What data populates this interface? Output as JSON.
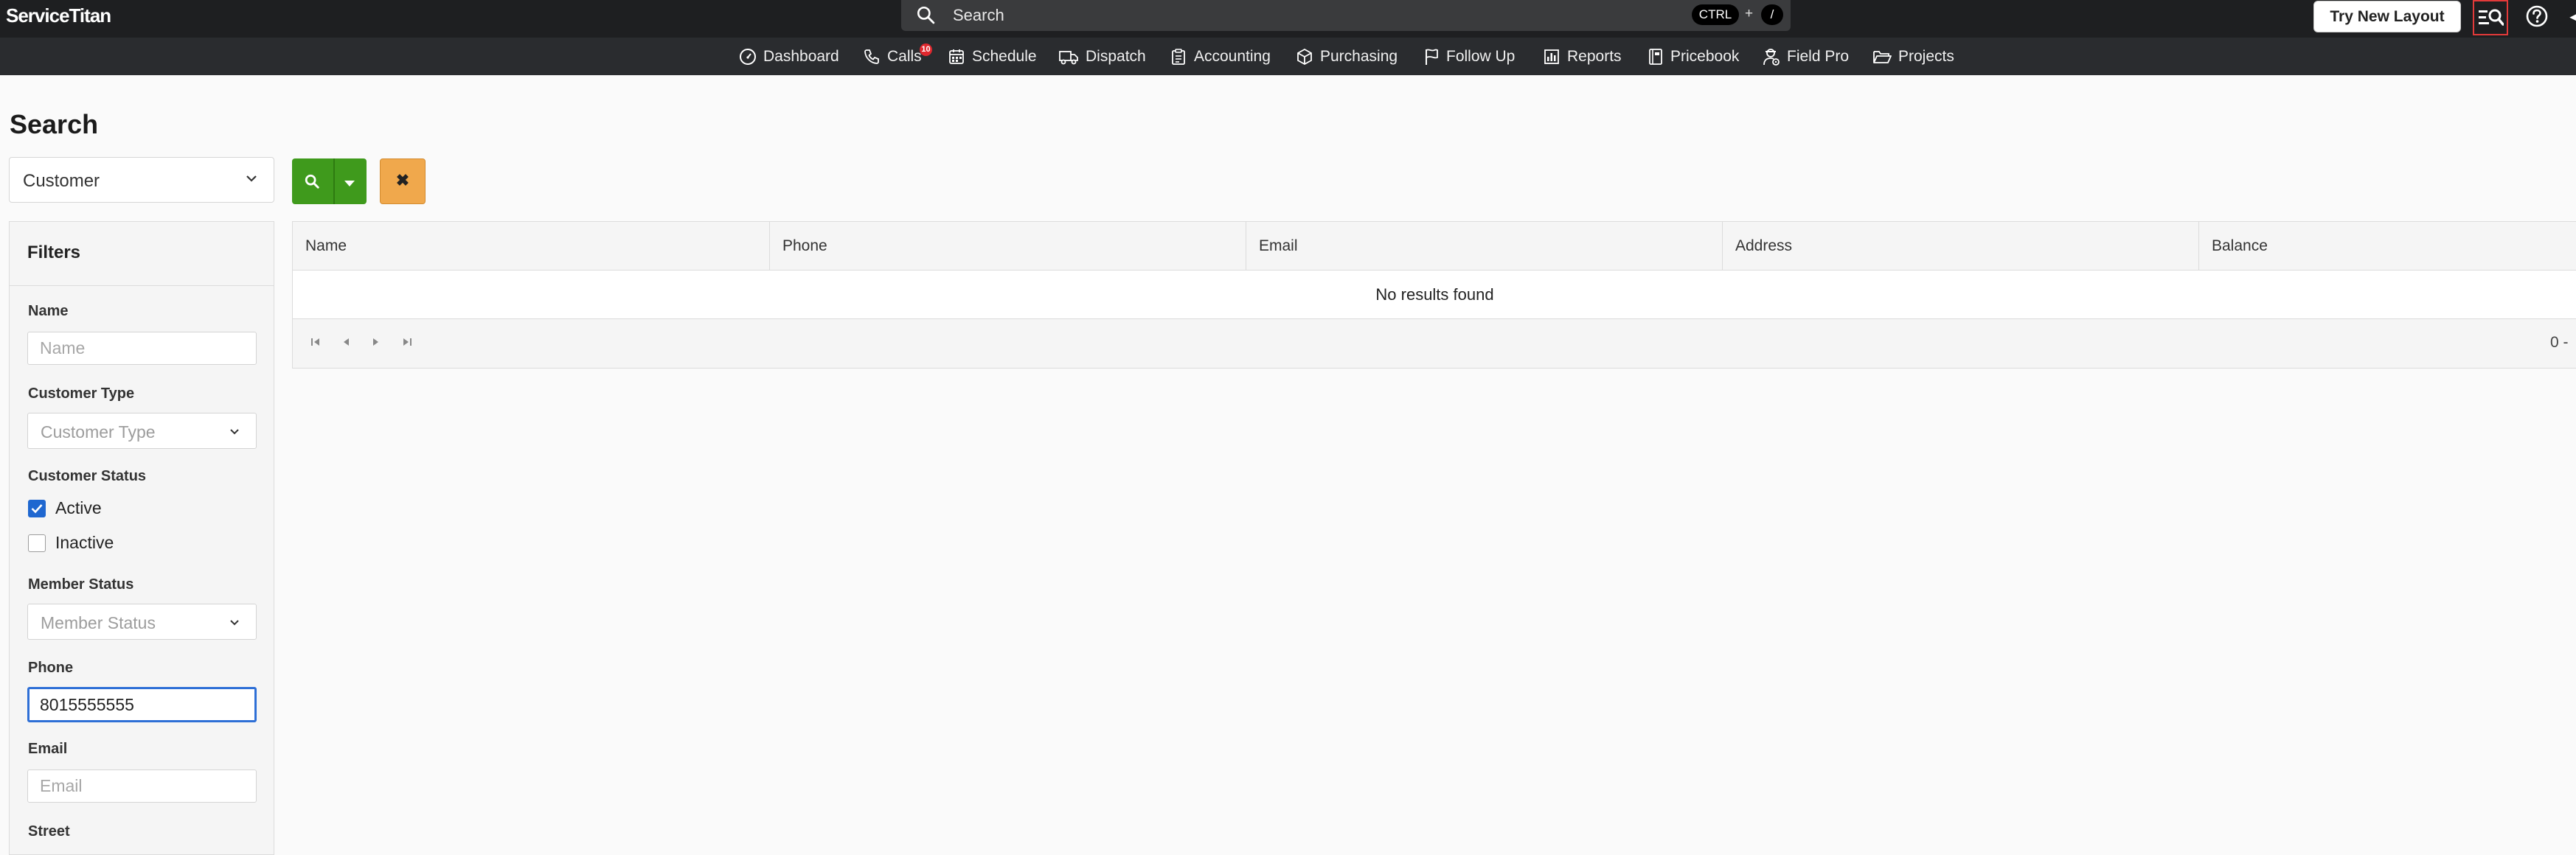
{
  "app": {
    "logo_text": "ServiceTitan",
    "search_placeholder": "Search",
    "shortcut_ctrl": "CTRL",
    "shortcut_plus": "+",
    "shortcut_slash": "/",
    "try_new_layout": "Try New Layout",
    "cut_off_icon_glyph": "◄"
  },
  "nav": {
    "items": [
      {
        "label": "Dashboard",
        "icon": "dashboard-icon"
      },
      {
        "label": "Calls",
        "icon": "phone-icon",
        "badge": "10"
      },
      {
        "label": "Schedule",
        "icon": "calendar-icon"
      },
      {
        "label": "Dispatch",
        "icon": "truck-icon"
      },
      {
        "label": "Accounting",
        "icon": "clipboard-icon"
      },
      {
        "label": "Purchasing",
        "icon": "box-icon"
      },
      {
        "label": "Follow Up",
        "icon": "flag-icon"
      },
      {
        "label": "Reports",
        "icon": "bar-chart-icon"
      },
      {
        "label": "Pricebook",
        "icon": "book-icon"
      },
      {
        "label": "Field Pro",
        "icon": "technician-icon"
      },
      {
        "label": "Projects",
        "icon": "folder-icon"
      }
    ]
  },
  "page": {
    "title": "Search",
    "entity_type": "Customer",
    "clear_glyph": "✖"
  },
  "filters": {
    "title": "Filters",
    "name_label": "Name",
    "name_placeholder": "Name",
    "customer_type_label": "Customer Type",
    "customer_type_placeholder": "Customer Type",
    "customer_status_label": "Customer Status",
    "status_active": "Active",
    "status_active_checked": true,
    "status_inactive": "Inactive",
    "status_inactive_checked": false,
    "member_status_label": "Member Status",
    "member_status_placeholder": "Member Status",
    "phone_label": "Phone",
    "phone_value": "8015555555",
    "email_label": "Email",
    "email_placeholder": "Email",
    "street_label": "Street"
  },
  "results": {
    "columns": [
      "Name",
      "Phone",
      "Email",
      "Address",
      "Balance"
    ],
    "empty_message": "No results found",
    "pager_info": "0 -"
  },
  "colors": {
    "topbar": "#1e1f21",
    "navbar": "#2a2c2f",
    "search_button": "#3f9a1c",
    "clear_button": "#f0a84c",
    "checkbox_checked": "#1f67d0",
    "focus_border": "#2e6fd6",
    "badge": "#e0282e",
    "highlight_box": "#e23a3a"
  }
}
